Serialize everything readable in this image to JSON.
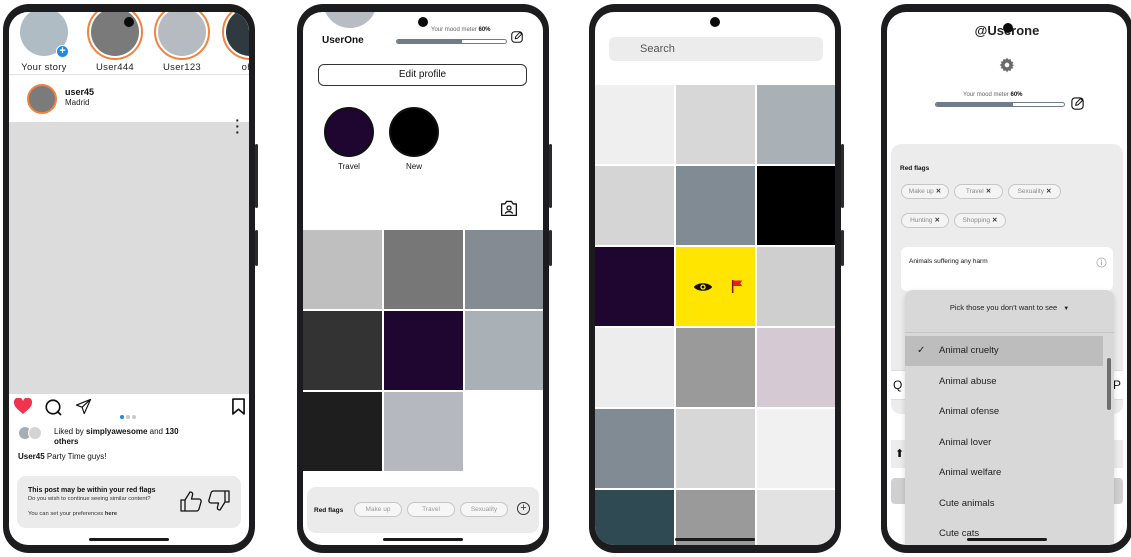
{
  "phone1": {
    "stories": [
      {
        "name": "Your story",
        "avatar_color": "#b0bcc4",
        "ring": false,
        "has_plus": true
      },
      {
        "name": "User444",
        "avatar_color": "#7a7a7a",
        "ring": true
      },
      {
        "name": "User123",
        "avatar_color": "#b5bbc0",
        "ring": true
      },
      {
        "name": "ohh",
        "avatar_color": "#2f3a40",
        "ring": true
      }
    ],
    "post": {
      "username": "user45",
      "location": "Madrid"
    },
    "likes": {
      "prefix": "Liked by ",
      "user": "simplyawesome",
      "middle": " and ",
      "count": "130",
      "suffix": "others"
    },
    "caption": {
      "user": "User45",
      "text": "Party Time guys!"
    },
    "red_flag_card": {
      "title": "This post may be within your red flags",
      "question": "Do you wish to continue seeing similar content?",
      "pref_prefix": "You can set your preferences ",
      "pref_link": "here"
    },
    "carousel": {
      "count": 3,
      "active": 0
    },
    "icons": [
      "heart-icon",
      "comment-icon",
      "send-icon",
      "bookmark-icon",
      "thumbs-up-icon",
      "thumbs-down-icon"
    ]
  },
  "phone2": {
    "username": "UserOne",
    "mood": {
      "label": "Your mood meter ",
      "value_text": "60%",
      "fraction": 0.6
    },
    "edit_profile": "Edit profile",
    "highlights": [
      {
        "label": "Travel",
        "color": "#1e0630"
      },
      {
        "label": "New",
        "color": "#000000"
      }
    ],
    "grid_colors": [
      "#bfbfbf",
      "#777777",
      "#848b93",
      "#333333",
      "#1e0630",
      "#a9b1b6",
      "#1e1e1e",
      "#b5b9bf",
      "#ffffff"
    ],
    "red_flags": {
      "label": "Red flags",
      "chips": [
        "Make up",
        "Travel",
        "Sexuality"
      ]
    }
  },
  "phone3": {
    "search_placeholder": "Search",
    "grid_colors": [
      "#efefef",
      "#d7d7d7",
      "#a9b1b6",
      "#d5d5d5",
      "#818b93",
      "#000000",
      "#1e0630",
      "#ffe500",
      "#cfcfcf",
      "#ededed",
      "#9a9a9a",
      "#d5c9d4",
      "#818b93",
      "#d7d7d7",
      "#f1f1f1",
      "#2f4a52",
      "#9a9a9a",
      "#e2e2e2"
    ],
    "highlight_cell_icons": [
      "eye-icon",
      "red-flag-icon"
    ],
    "flag_color": "#e02020"
  },
  "phone4": {
    "handle": "@Userone",
    "mood": {
      "label": "Your mood meter ",
      "value_text": "60%",
      "fraction": 0.6
    },
    "red_flags": {
      "label": "Red flags",
      "chips": [
        "Make up",
        "Travel",
        "Sexuality",
        "Hunting",
        "Shopping"
      ]
    },
    "input_value": "Animals suffering any harm",
    "dropdown": {
      "header": "Pick those you don't want to see",
      "options": [
        "Animal cruelty",
        "Animal abuse",
        "Animal ofense",
        "Animal lover",
        "Animal welfare",
        "Cute animals",
        "Cute cats"
      ],
      "selected_index": 0
    },
    "partial": {
      "left": "Q",
      "right": "P",
      "up": "⬆"
    }
  }
}
